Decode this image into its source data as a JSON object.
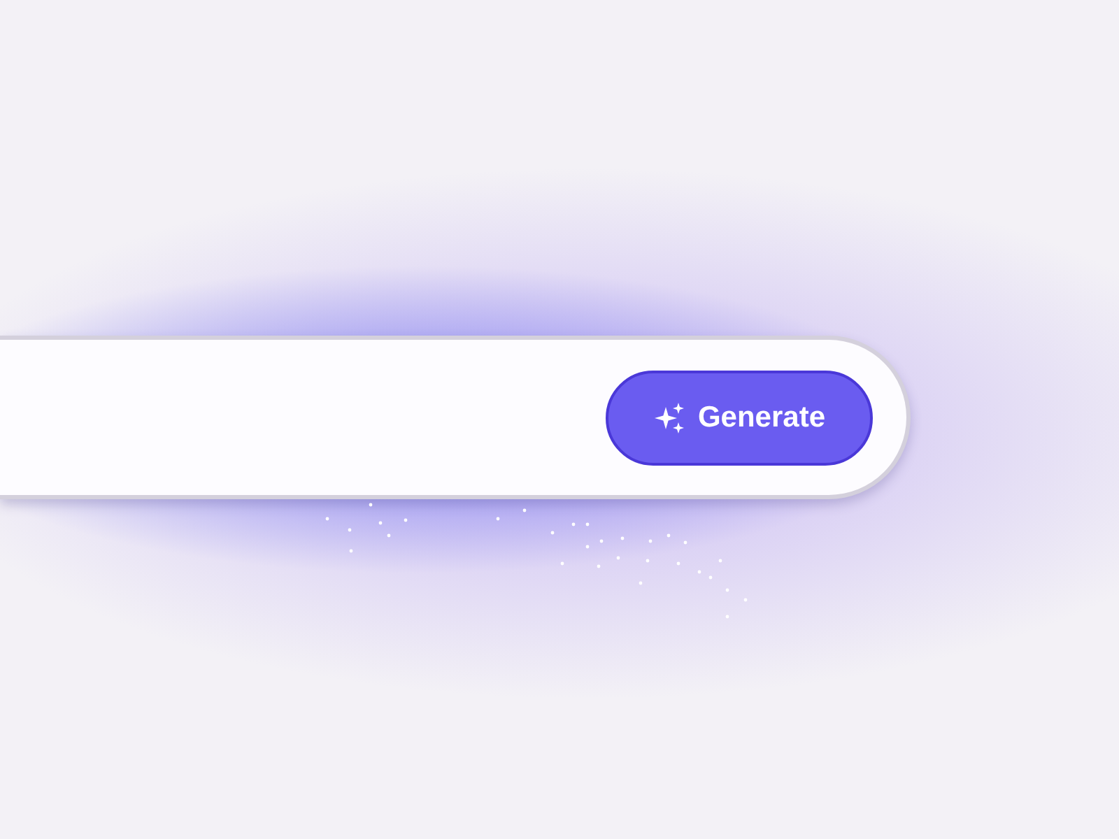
{
  "generate_button": {
    "label": "Generate"
  }
}
